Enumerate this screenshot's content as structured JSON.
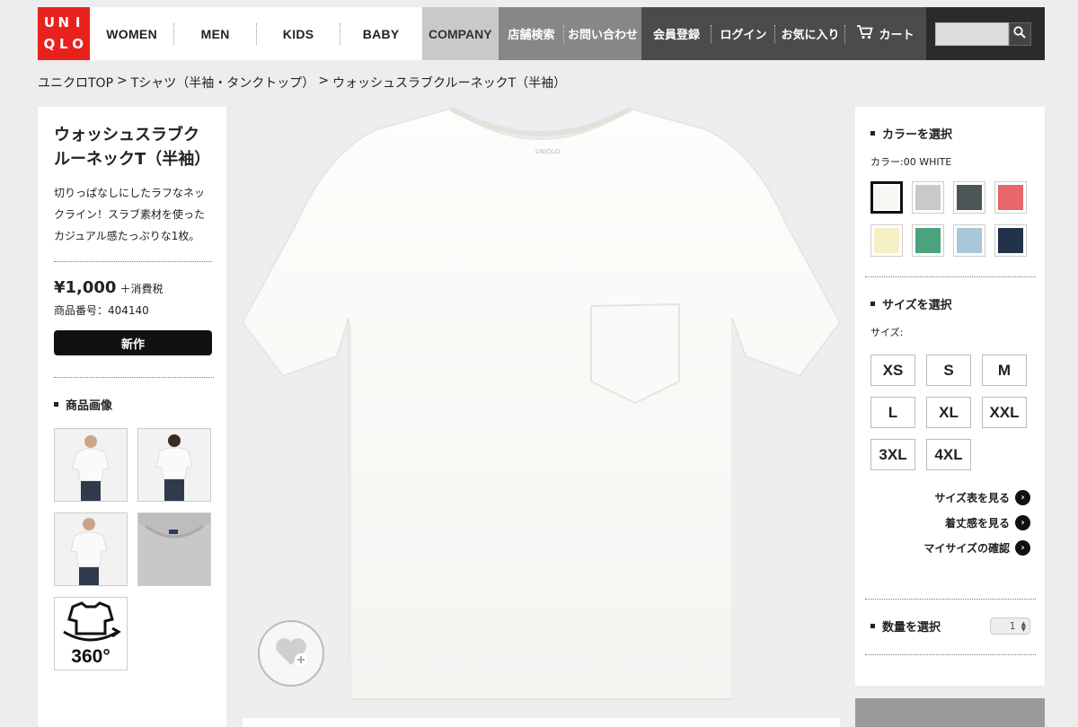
{
  "header": {
    "logo_letters": [
      "U",
      "N",
      "I",
      "Q",
      "L",
      "O"
    ],
    "nav_main": [
      "WOMEN",
      "MEN",
      "KIDS",
      "BABY"
    ],
    "company": "COMPANY",
    "nav_mid": [
      "店舗検索",
      "お問い合わせ"
    ],
    "nav_dark": [
      "会員登録",
      "ログイン",
      "お気に入り",
      "カート"
    ],
    "search_placeholder": ""
  },
  "breadcrumb": [
    "ユニクロTOP",
    ">",
    "Tシャツ（半袖・タンクトップ）",
    ">",
    "ウォッシュスラブクルーネックT（半袖）"
  ],
  "product": {
    "title": "ウォッシュスラブクルーネックT（半袖）",
    "description": "切りっぱなしにしたラフなネックライン！スラブ素材を使ったカジュアル感たっぷりな1枚。",
    "price": "¥1,000",
    "tax_label": "＋消費税",
    "product_number": "商品番号：404140",
    "badge": "新作",
    "images_heading": "商品画像",
    "thumbnail_360_label": "360°"
  },
  "color": {
    "heading": "カラーを選択",
    "selected_label": "カラー:00 WHITE",
    "swatches": [
      "#f7f6f2",
      "#c9c9c9",
      "#4d5458",
      "#e7676a",
      "#f7f0c7",
      "#4ca27a",
      "#a9c7d6",
      "#223248"
    ]
  },
  "size": {
    "heading": "サイズを選択",
    "label": "サイズ:",
    "options": [
      "XS",
      "S",
      "M",
      "L",
      "XL",
      "XXL",
      "3XL",
      "4XL"
    ]
  },
  "links": [
    "サイズ表を見る",
    "着丈感を見る",
    "マイサイズの確認"
  ],
  "quantity": {
    "heading": "数量を選択",
    "value": "1"
  },
  "tshirt_label": "UNIQLO"
}
